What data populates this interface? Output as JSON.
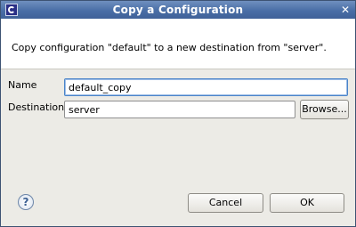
{
  "window": {
    "title": "Copy a Configuration",
    "app_icon": "eclipse-icon",
    "close_icon": "close-icon",
    "close_glyph": "✕"
  },
  "banner": {
    "message": "Copy configuration \"default\" to a new destination from \"server\"."
  },
  "form": {
    "name_label": "Name",
    "name_value": "default_copy",
    "destination_label": "Destination",
    "destination_value": "server",
    "browse_label": "Browse..."
  },
  "footer": {
    "help_icon": "help-icon",
    "help_glyph": "?",
    "cancel_label": "Cancel",
    "ok_label": "OK"
  }
}
